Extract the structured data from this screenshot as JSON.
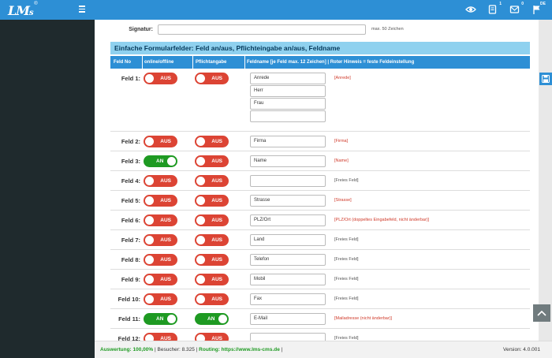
{
  "app": {
    "logo_main": "LM",
    "logo_sub": "s",
    "logo_reg": "®"
  },
  "topbar": {
    "icons": [
      {
        "name": "eye-icon",
        "badge": ""
      },
      {
        "name": "notes-icon",
        "badge": "1"
      },
      {
        "name": "mail-icon",
        "badge": "0"
      },
      {
        "name": "flag-icon",
        "badge": "DE"
      }
    ]
  },
  "signatur": {
    "label": "Signatur:",
    "value": "",
    "hint": "max. 50 Zeichen"
  },
  "section": {
    "title": "Einfache Formularfelder: Feld an/aus, Pflichteingabe an/aus, Feldname"
  },
  "columns": {
    "feld_no": "Feld No",
    "online": "online/offline",
    "pflicht": "Pflichtangabe",
    "feldname": "Feldname [je Feld max. 12 Zeichen] | Roter Hinweis = feste Feldeinstellung"
  },
  "toggle_labels": {
    "on": "AN",
    "off": "AUS"
  },
  "fields": [
    {
      "label": "Feld 1:",
      "online": false,
      "pflicht": false,
      "values": [
        "Anrede",
        "Herr",
        "Frau",
        ""
      ],
      "hint": "[Anrede]",
      "hint_red": true
    },
    {
      "label": "Feld 2:",
      "online": false,
      "pflicht": false,
      "values": [
        "Firma"
      ],
      "hint": "[Firma]",
      "hint_red": true
    },
    {
      "label": "Feld 3:",
      "online": true,
      "pflicht": false,
      "values": [
        "Name"
      ],
      "hint": "[Name]",
      "hint_red": true
    },
    {
      "label": "Feld 4:",
      "online": false,
      "pflicht": false,
      "values": [
        ""
      ],
      "hint": "[Freies Feld]",
      "hint_red": false
    },
    {
      "label": "Feld 5:",
      "online": false,
      "pflicht": false,
      "values": [
        "Strasse"
      ],
      "hint": "[Strasse]",
      "hint_red": true
    },
    {
      "label": "Feld 6:",
      "online": false,
      "pflicht": false,
      "values": [
        "PLZ/Ort"
      ],
      "hint": "[PLZ/Ort (doppeltes Eingabefeld, nicht änderbar)]",
      "hint_red": true
    },
    {
      "label": "Feld 7:",
      "online": false,
      "pflicht": false,
      "values": [
        "Land"
      ],
      "hint": "[Freies Feld]",
      "hint_red": false
    },
    {
      "label": "Feld 8:",
      "online": false,
      "pflicht": false,
      "values": [
        "Telefon"
      ],
      "hint": "[Freies Feld]",
      "hint_red": false
    },
    {
      "label": "Feld 9:",
      "online": false,
      "pflicht": false,
      "values": [
        "Mobil"
      ],
      "hint": "[Freies Feld]",
      "hint_red": false
    },
    {
      "label": "Feld 10:",
      "online": false,
      "pflicht": false,
      "values": [
        "Fax"
      ],
      "hint": "[Freies Feld]",
      "hint_red": false
    },
    {
      "label": "Feld 11:",
      "online": true,
      "pflicht": true,
      "values": [
        "E-Mail"
      ],
      "hint": "[Mailadresse (nicht änderbar)]",
      "hint_red": true
    },
    {
      "label": "Feld 12:",
      "online": false,
      "pflicht": false,
      "values": [
        ""
      ],
      "hint": "[Freies Feld]",
      "hint_red": false
    }
  ],
  "footer": {
    "auswertung": "Auswertung: 100,00%",
    "sep1": " | ",
    "besucher": "Besucher: 8.325",
    "sep2": " | ",
    "routing": "Routing: https://www.lms-cms.de",
    "sep3": " |",
    "version": "Version: 4.0.001"
  },
  "colors": {
    "accent": "#2d8fd5",
    "section_bg": "#8fd1ef",
    "on": "#1e9a22",
    "off": "#dc4434",
    "sidebar": "#1f2a2d"
  }
}
